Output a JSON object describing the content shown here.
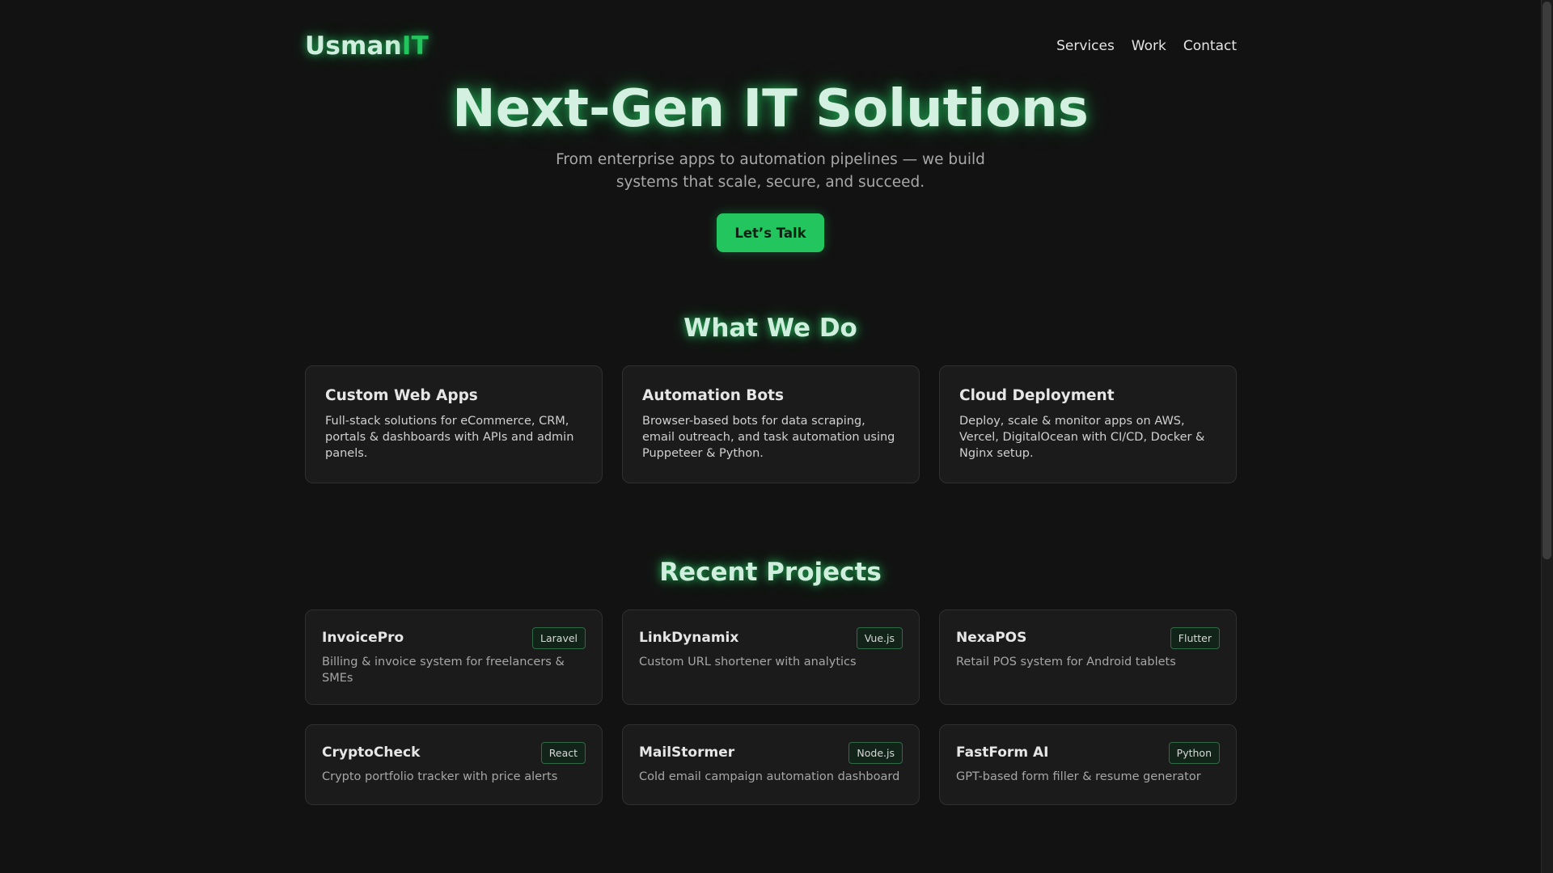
{
  "brand": {
    "name_main": "Usman",
    "name_accent": "IT"
  },
  "nav": [
    "Services",
    "Work",
    "Contact"
  ],
  "hero": {
    "title": "Next-Gen IT Solutions",
    "subtitle": "From enterprise apps to automation pipelines — we build systems that scale, secure, and succeed.",
    "cta_label": "Let’s Talk"
  },
  "services": {
    "title": "What We Do",
    "items": [
      {
        "title": "Custom Web Apps",
        "desc": "Full-stack solutions for eCommerce, CRM, portals & dashboards with APIs and admin panels."
      },
      {
        "title": "Automation Bots",
        "desc": "Browser-based bots for data scraping, email outreach, and task automation using Puppeteer & Python."
      },
      {
        "title": "Cloud Deployment",
        "desc": "Deploy, scale & monitor apps on AWS, Vercel, DigitalOcean with CI/CD, Docker & Nginx setup."
      }
    ]
  },
  "projects": {
    "title": "Recent Projects",
    "items": [
      {
        "name": "InvoicePro",
        "tag": "Laravel",
        "desc": "Billing & invoice system for freelancers & SMEs"
      },
      {
        "name": "LinkDynamix",
        "tag": "Vue.js",
        "desc": "Custom URL shortener with analytics"
      },
      {
        "name": "NexaPOS",
        "tag": "Flutter",
        "desc": "Retail POS system for Android tablets"
      },
      {
        "name": "CryptoCheck",
        "tag": "React",
        "desc": "Crypto portfolio tracker with price alerts"
      },
      {
        "name": "MailStormer",
        "tag": "Node.js",
        "desc": "Cold email campaign automation dashboard"
      },
      {
        "name": "FastForm AI",
        "tag": "Python",
        "desc": "GPT-based form filler & resume generator"
      }
    ]
  },
  "colors": {
    "accent": "#22c55e",
    "background": "#121212",
    "card": "#1b1b1b"
  }
}
